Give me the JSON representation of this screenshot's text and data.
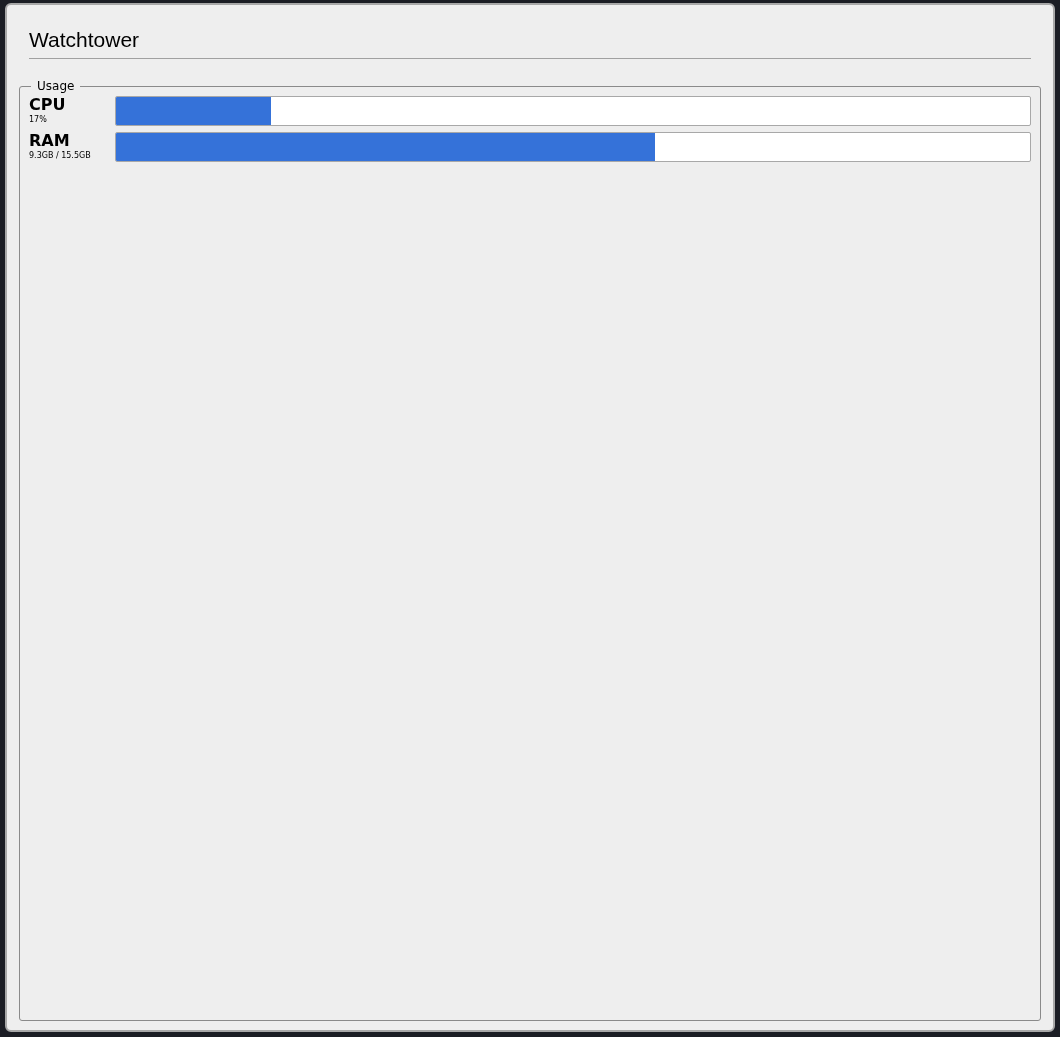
{
  "window": {
    "title": "Watchtower"
  },
  "usage": {
    "title": "Usage",
    "meters": [
      {
        "name": "CPU",
        "reading": "17%",
        "level": 0.17
      },
      {
        "name": "RAM",
        "reading": "9.3GB / 15.5GB",
        "level": 0.59
      }
    ]
  }
}
